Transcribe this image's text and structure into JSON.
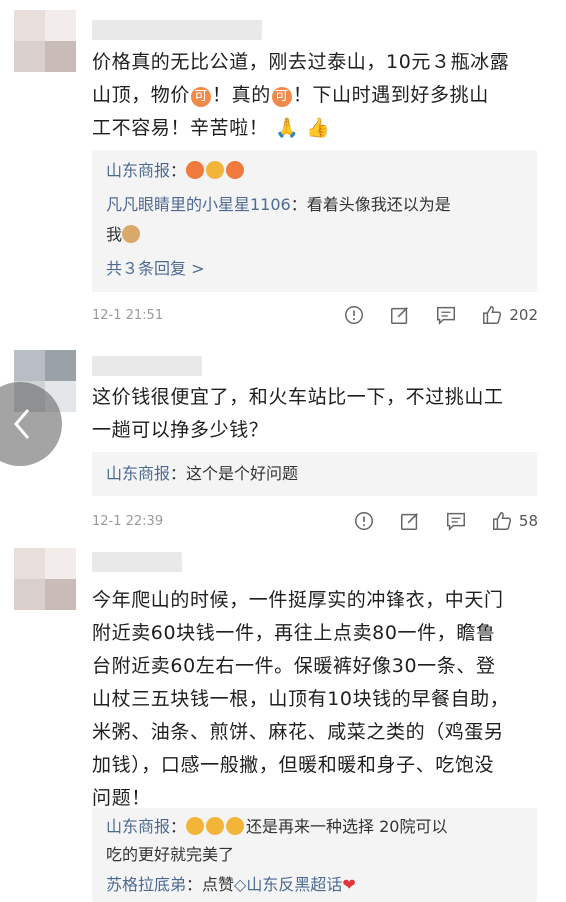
{
  "comments": [
    {
      "text_lines": [
        "价格真的无比公道，刚去过泰山，10元３瓶冰露",
        "山顶，物价",
        "！真的",
        "！下山时遇到好多挑山",
        "工不容易！辛苦啦！"
      ],
      "ke_label": "可",
      "replies": [
        {
          "author": "山东商报",
          "sep": "：",
          "text": ""
        },
        {
          "author": "凡凡眼睛里的小星星1106",
          "sep": "：",
          "text": "看着头像我还以为是"
        },
        {
          "author": "",
          "sep": "",
          "text": "我"
        }
      ],
      "more": "共３条回复 >",
      "time": "12-1 21:51",
      "likes": "202"
    },
    {
      "text_lines": [
        "这价钱很便宜了，和火车站比一下，不过挑山工",
        "一趟可以挣多少钱？"
      ],
      "replies": [
        {
          "author": "山东商报",
          "sep": "：",
          "text": "这个是个好问题"
        }
      ],
      "time": "12-1 22:39",
      "likes": "58"
    },
    {
      "text_lines": [
        "今年爬山的时候，一件挺厚实的冲锋衣，中天门",
        "附近卖60块钱一件，再往上点卖80一件，瞻鲁",
        "台附近卖60左右一件。保暖裤好像30一条、登",
        "山杖三五块钱一根，山顶有10块钱的早餐自助，",
        "米粥、油条、煎饼、麻花、咸菜之类的（鸡蛋另",
        "加钱），口感一般撇，但暖和暖和身子、吃饱没",
        "问题！"
      ],
      "replies": [
        {
          "author": "山东商报",
          "sep": "：",
          "text": "还是再来一种选择 20院可以"
        },
        {
          "author": "",
          "sep": "",
          "text": "吃的更好就完美了"
        },
        {
          "author": "苏格拉底弟",
          "sep": "：",
          "text": "点赞",
          "tail": "山东反黑超话"
        }
      ]
    }
  ]
}
